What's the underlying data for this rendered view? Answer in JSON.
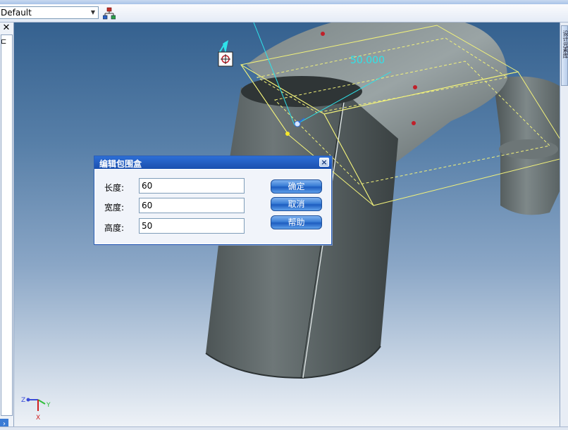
{
  "toolbar": {
    "config_select": {
      "value": "Default"
    }
  },
  "left_panel": {
    "close_glyph": "✕",
    "expand_glyph": "›"
  },
  "right_panel": {
    "tab_label": "设计元素库"
  },
  "viewport": {
    "dimension_label": "50.000",
    "triad": {
      "x_label": "X",
      "y_label": "Y",
      "z_label": "Z"
    }
  },
  "dialog": {
    "title": "编辑包围盒",
    "close_glyph": "×",
    "fields": [
      {
        "label": "长度:",
        "value": "60"
      },
      {
        "label": "宽度:",
        "value": "60"
      },
      {
        "label": "高度:",
        "value": "50"
      }
    ],
    "buttons": {
      "ok": "确定",
      "cancel": "取消",
      "help": "帮助"
    }
  },
  "colors": {
    "accent": "#2d6ed6",
    "dimension": "#2ee3ea",
    "bounding_box": "#f2f27a",
    "handle": "#c0202a"
  }
}
